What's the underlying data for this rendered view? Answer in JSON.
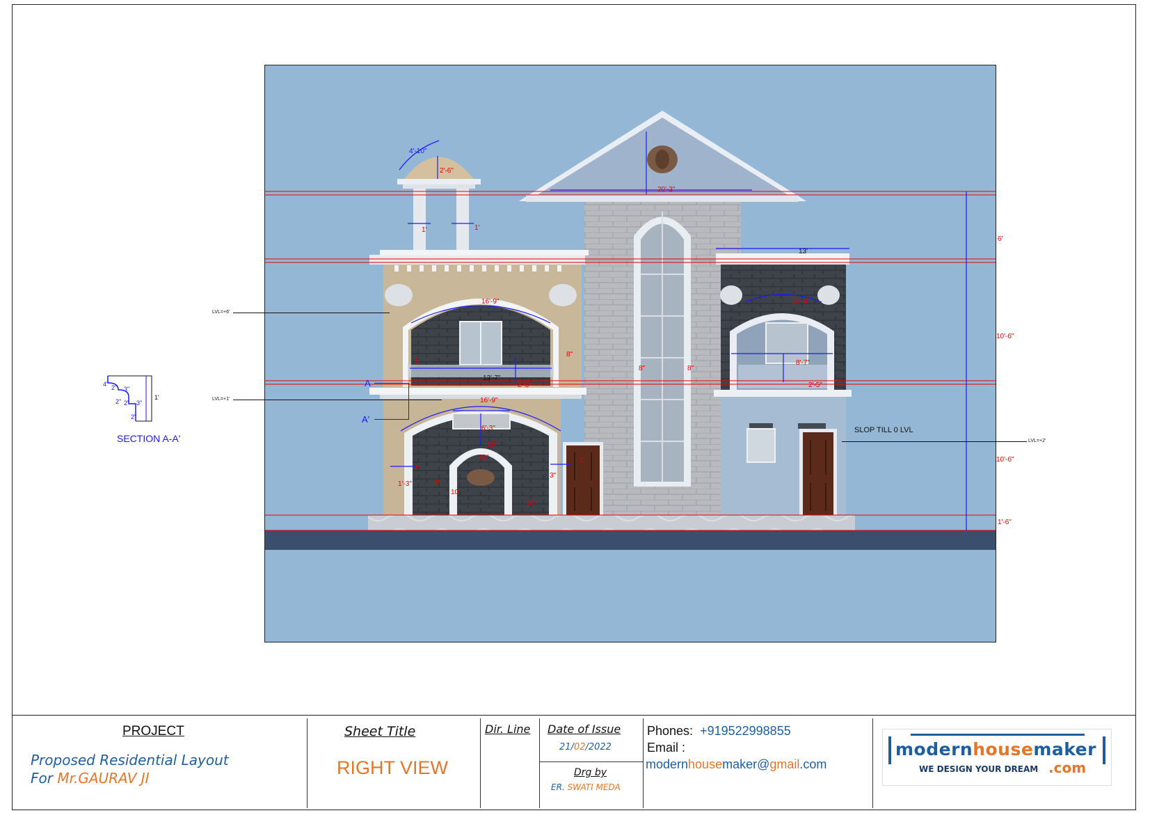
{
  "drawing": {
    "section_label": "SECTION A-A'",
    "section_marker_top": "A",
    "section_marker_bottom": "A'",
    "slop_note": "SLOP TILL 0 LVL",
    "level_labels": {
      "lvl_plus6": "LVL=+6'",
      "lvl_plus1": "LVL=+1'",
      "lvl_plus2": "LVL=+2'"
    },
    "section_dims": [
      "4\"",
      "2\"",
      "3\"",
      "2\"",
      "2\"",
      "3\"",
      "2\"",
      "1'"
    ],
    "dimensions": {
      "dome_arc": "4'-10\"",
      "dome_height": "2'-6\"",
      "gable_width": "20'-3\"",
      "col_1": "1'",
      "col_2": "1'",
      "right_block_width": "13'",
      "arch_upper": "16'-9\"",
      "balcony_width": "13'-7\"",
      "rail_height": "2'-5\"",
      "arch_mid": "16'-9\"",
      "door_arch": "6'-3\"",
      "door_10": "10\"",
      "vert_10": "10\"",
      "right_arch": "13'-4\"",
      "right_balcony": "8'-7\"",
      "right_rail": "2'-5\"",
      "win_8a": "8\"",
      "win_8b": "8\"",
      "slot_8a": "8\"",
      "slot_8b": "8\"",
      "small_1_3": "1'-3\"",
      "small_3a": "3\"",
      "small_3b": "3\"",
      "small_4": "4\"",
      "small_1": "1'",
      "small_10a": "10\"",
      "small_10b": "10\"",
      "rdim_6": "6'",
      "rdim_10_6a": "10'-6\"",
      "rdim_10_6b": "10'-6\"",
      "rdim_1_6": "1'-6\""
    }
  },
  "title_block": {
    "project_heading": "PROJECT",
    "project_line1": "Proposed Residential Layout",
    "project_line2_prefix": "For ",
    "project_line2_name": "Mr.GAURAV JI",
    "sheet_title_heading": "Sheet Title",
    "sheet_title_value": "RIGHT VIEW",
    "dir_line_heading": "Dir. Line",
    "date_heading": "Date of Issue",
    "date_day": "21/",
    "date_month": "02",
    "date_year": "/2022",
    "drg_by_heading": "Drg by",
    "drg_by_prefix": "ER. ",
    "drg_by_name": "SWATI MEDA",
    "phones_label": "Phones:",
    "phones_value": "+919522998855",
    "email_label": "Email :",
    "email_part1": "modern",
    "email_part2": "house",
    "email_part3": "maker@",
    "email_part4": "gmail",
    "email_part5": ".com",
    "logo_part1": "modern",
    "logo_part2": "house",
    "logo_part3": "maker",
    "logo_tagline": "WE DESIGN YOUR DREAM",
    "logo_com": ".com"
  },
  "colors": {
    "sky": "#94b7d6",
    "dim_blue": "#1a1aff",
    "dim_red": "#e60000",
    "brand_blue": "#1f5e9e",
    "brand_orange": "#e2762a"
  }
}
